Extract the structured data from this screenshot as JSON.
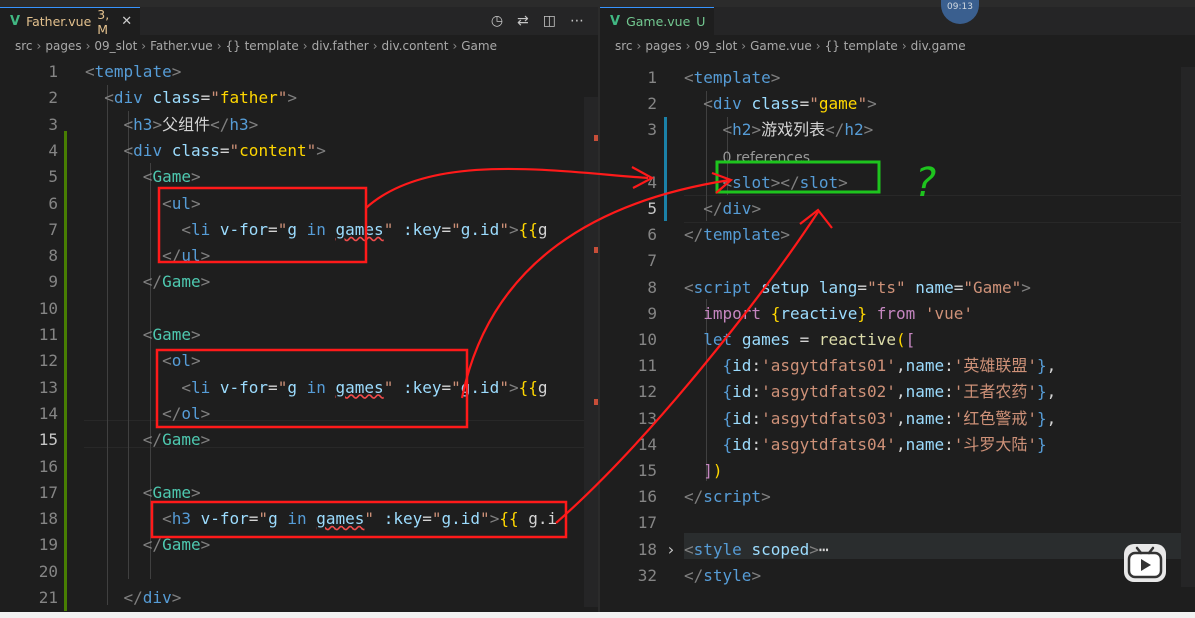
{
  "left_tab": {
    "label": "Father.vue",
    "badge": "3, M",
    "close": "✕"
  },
  "left_actions": [
    "history-icon",
    "compare-icon",
    "split-icon",
    "more-icon"
  ],
  "left_breadcrumb": [
    "src",
    "pages",
    "09_slot",
    "Father.vue",
    "{} template",
    "div.father",
    "div.content",
    "Game"
  ],
  "right_tab": {
    "label": "Game.vue",
    "badge": "U",
    "close": "✕"
  },
  "right_breadcrumb": [
    "src",
    "pages",
    "09_slot",
    "Game.vue",
    "{} template",
    "div.game"
  ],
  "overlay": {
    "avatar_text": "09:13",
    "question_mark": "?"
  },
  "left_lines": [
    {
      "n": "1",
      "indent": "",
      "segs": [
        [
          "b",
          "<"
        ],
        [
          "t",
          "template"
        ],
        [
          "b",
          ">"
        ]
      ]
    },
    {
      "n": "2",
      "indent": "  ",
      "segs": [
        [
          "b",
          "<"
        ],
        [
          "t",
          "div"
        ],
        [
          "w",
          " "
        ],
        [
          "a",
          "class"
        ],
        [
          "w",
          "="
        ],
        [
          "s",
          "\""
        ],
        [
          "y",
          "father"
        ],
        [
          "s",
          "\""
        ],
        [
          "b",
          ">"
        ]
      ]
    },
    {
      "n": "3",
      "indent": "    ",
      "segs": [
        [
          "b",
          "<"
        ],
        [
          "t",
          "h3"
        ],
        [
          "b",
          ">"
        ],
        [
          "w",
          "父组件"
        ],
        [
          "b",
          "</"
        ],
        [
          "t",
          "h3"
        ],
        [
          "b",
          ">"
        ]
      ]
    },
    {
      "n": "4",
      "indent": "    ",
      "segs": [
        [
          "b",
          "<"
        ],
        [
          "t",
          "div"
        ],
        [
          "w",
          " "
        ],
        [
          "a",
          "class"
        ],
        [
          "w",
          "="
        ],
        [
          "s",
          "\""
        ],
        [
          "y",
          "content"
        ],
        [
          "s",
          "\""
        ],
        [
          "b",
          ">"
        ]
      ]
    },
    {
      "n": "5",
      "indent": "      ",
      "segs": [
        [
          "b",
          "<"
        ],
        [
          "tg",
          "Game"
        ],
        [
          "b",
          ">"
        ]
      ]
    },
    {
      "n": "6",
      "indent": "        ",
      "segs": [
        [
          "b",
          "<"
        ],
        [
          "t",
          "ul"
        ],
        [
          "b",
          ">"
        ]
      ]
    },
    {
      "n": "7",
      "indent": "          ",
      "segs": [
        [
          "b",
          "<"
        ],
        [
          "t",
          "li"
        ],
        [
          "w",
          " "
        ],
        [
          "a",
          "v-for"
        ],
        [
          "w",
          "="
        ],
        [
          "s",
          "\""
        ],
        [
          "a",
          "g"
        ],
        [
          "w",
          " "
        ],
        [
          "t",
          "in"
        ],
        [
          "w",
          " "
        ],
        [
          "a",
          "games"
        ],
        [
          "s",
          "\""
        ],
        [
          "w",
          " "
        ],
        [
          "a",
          ":key"
        ],
        [
          "w",
          "="
        ],
        [
          "s",
          "\""
        ],
        [
          "a",
          "g.id"
        ],
        [
          "s",
          "\""
        ],
        [
          "b",
          ">"
        ],
        [
          "y",
          "{{"
        ],
        [
          "w",
          "g"
        ]
      ]
    },
    {
      "n": "8",
      "indent": "        ",
      "segs": [
        [
          "b",
          "</"
        ],
        [
          "t",
          "ul"
        ],
        [
          "b",
          ">"
        ]
      ]
    },
    {
      "n": "9",
      "indent": "      ",
      "segs": [
        [
          "b",
          "</"
        ],
        [
          "tg",
          "Game"
        ],
        [
          "b",
          ">"
        ]
      ]
    },
    {
      "n": "10",
      "indent": "",
      "segs": []
    },
    {
      "n": "11",
      "indent": "      ",
      "segs": [
        [
          "b",
          "<"
        ],
        [
          "tg",
          "Game"
        ],
        [
          "b",
          ">"
        ]
      ]
    },
    {
      "n": "12",
      "indent": "        ",
      "segs": [
        [
          "b",
          "<"
        ],
        [
          "t",
          "ol"
        ],
        [
          "b",
          ">"
        ]
      ]
    },
    {
      "n": "13",
      "indent": "          ",
      "segs": [
        [
          "b",
          "<"
        ],
        [
          "t",
          "li"
        ],
        [
          "w",
          " "
        ],
        [
          "a",
          "v-for"
        ],
        [
          "w",
          "="
        ],
        [
          "s",
          "\""
        ],
        [
          "a",
          "g"
        ],
        [
          "w",
          " "
        ],
        [
          "t",
          "in"
        ],
        [
          "w",
          " "
        ],
        [
          "a",
          "games"
        ],
        [
          "s",
          "\""
        ],
        [
          "w",
          " "
        ],
        [
          "a",
          ":key"
        ],
        [
          "w",
          "="
        ],
        [
          "s",
          "\""
        ],
        [
          "a",
          "g.id"
        ],
        [
          "s",
          "\""
        ],
        [
          "b",
          ">"
        ],
        [
          "y",
          "{{"
        ],
        [
          "w",
          "g"
        ]
      ]
    },
    {
      "n": "14",
      "indent": "        ",
      "segs": [
        [
          "b",
          "</"
        ],
        [
          "t",
          "ol"
        ],
        [
          "b",
          ">"
        ]
      ]
    },
    {
      "n": "15",
      "indent": "      ",
      "segs": [
        [
          "b",
          "</"
        ],
        [
          "tg",
          "Game"
        ],
        [
          "b",
          ">"
        ]
      ],
      "active": true
    },
    {
      "n": "16",
      "indent": "",
      "segs": []
    },
    {
      "n": "17",
      "indent": "      ",
      "segs": [
        [
          "b",
          "<"
        ],
        [
          "tg",
          "Game"
        ],
        [
          "b",
          ">"
        ]
      ]
    },
    {
      "n": "18",
      "indent": "        ",
      "segs": [
        [
          "b",
          "<"
        ],
        [
          "t",
          "h3"
        ],
        [
          "w",
          " "
        ],
        [
          "a",
          "v-for"
        ],
        [
          "w",
          "="
        ],
        [
          "s",
          "\""
        ],
        [
          "a",
          "g"
        ],
        [
          "w",
          " "
        ],
        [
          "t",
          "in"
        ],
        [
          "w",
          " "
        ],
        [
          "a",
          "games"
        ],
        [
          "s",
          "\""
        ],
        [
          "w",
          " "
        ],
        [
          "a",
          ":key"
        ],
        [
          "w",
          "="
        ],
        [
          "s",
          "\""
        ],
        [
          "a",
          "g.id"
        ],
        [
          "s",
          "\""
        ],
        [
          "b",
          ">"
        ],
        [
          "y",
          "{{"
        ],
        [
          "w",
          " g.i"
        ]
      ]
    },
    {
      "n": "19",
      "indent": "      ",
      "segs": [
        [
          "b",
          "</"
        ],
        [
          "tg",
          "Game"
        ],
        [
          "b",
          ">"
        ]
      ]
    },
    {
      "n": "20",
      "indent": "",
      "segs": []
    },
    {
      "n": "21",
      "indent": "    ",
      "segs": [
        [
          "b",
          "</"
        ],
        [
          "t",
          "div"
        ],
        [
          "b",
          ">"
        ]
      ]
    }
  ],
  "right_lines": [
    {
      "n": "1",
      "indent": "",
      "segs": [
        [
          "b",
          "<"
        ],
        [
          "t",
          "template"
        ],
        [
          "b",
          ">"
        ]
      ]
    },
    {
      "n": "2",
      "indent": "  ",
      "segs": [
        [
          "b",
          "<"
        ],
        [
          "t",
          "div"
        ],
        [
          "w",
          " "
        ],
        [
          "a",
          "class"
        ],
        [
          "w",
          "="
        ],
        [
          "s",
          "\""
        ],
        [
          "y",
          "game"
        ],
        [
          "s",
          "\""
        ],
        [
          "b",
          ">"
        ]
      ]
    },
    {
      "n": "3",
      "indent": "    ",
      "segs": [
        [
          "b",
          "<"
        ],
        [
          "t",
          "h2"
        ],
        [
          "b",
          ">"
        ],
        [
          "w",
          "游戏列表"
        ],
        [
          "b",
          "</"
        ],
        [
          "t",
          "h2"
        ],
        [
          "b",
          ">"
        ]
      ]
    },
    {
      "n": "",
      "indent": "    ",
      "segs": [
        [
          "refs",
          "0 references"
        ]
      ]
    },
    {
      "n": "4",
      "indent": "    ",
      "segs": [
        [
          "b",
          "<"
        ],
        [
          "t",
          "slot"
        ],
        [
          "b",
          "></"
        ],
        [
          "t",
          "slot"
        ],
        [
          "b",
          ">"
        ]
      ]
    },
    {
      "n": "5",
      "indent": "  ",
      "segs": [
        [
          "b",
          "</"
        ],
        [
          "t",
          "div"
        ],
        [
          "b",
          ">"
        ]
      ],
      "active": true
    },
    {
      "n": "6",
      "indent": "",
      "segs": [
        [
          "b",
          "</"
        ],
        [
          "t",
          "template"
        ],
        [
          "b",
          ">"
        ]
      ]
    },
    {
      "n": "7",
      "indent": "",
      "segs": []
    },
    {
      "n": "8",
      "indent": "",
      "segs": [
        [
          "b",
          "<"
        ],
        [
          "t",
          "script"
        ],
        [
          "w",
          " "
        ],
        [
          "a",
          "setup"
        ],
        [
          "w",
          " "
        ],
        [
          "a",
          "lang"
        ],
        [
          "w",
          "="
        ],
        [
          "s",
          "\"ts\""
        ],
        [
          "w",
          " "
        ],
        [
          "a",
          "name"
        ],
        [
          "w",
          "="
        ],
        [
          "s",
          "\"Game\""
        ],
        [
          "b",
          ">"
        ]
      ]
    },
    {
      "n": "9",
      "indent": "  ",
      "segs": [
        [
          "k",
          "import"
        ],
        [
          "w",
          " "
        ],
        [
          "y",
          "{"
        ],
        [
          "a",
          "reactive"
        ],
        [
          "y",
          "}"
        ],
        [
          "w",
          " "
        ],
        [
          "k",
          "from"
        ],
        [
          "w",
          " "
        ],
        [
          "s",
          "'vue'"
        ]
      ]
    },
    {
      "n": "10",
      "indent": "  ",
      "segs": [
        [
          "t",
          "let"
        ],
        [
          "w",
          " "
        ],
        [
          "a",
          "games"
        ],
        [
          "w",
          " = "
        ],
        [
          "f",
          "reactive"
        ],
        [
          "y",
          "("
        ],
        [
          "k",
          "["
        ]
      ]
    },
    {
      "n": "11",
      "indent": "    ",
      "segs": [
        [
          "t",
          "{"
        ],
        [
          "a",
          "id"
        ],
        [
          "w",
          ":"
        ],
        [
          "s",
          "'asgytdfats01'"
        ],
        [
          "w",
          ","
        ],
        [
          "a",
          "name"
        ],
        [
          "w",
          ":"
        ],
        [
          "s",
          "'英雄联盟'"
        ],
        [
          "t",
          "}"
        ],
        [
          "w",
          ","
        ]
      ]
    },
    {
      "n": "12",
      "indent": "    ",
      "segs": [
        [
          "t",
          "{"
        ],
        [
          "a",
          "id"
        ],
        [
          "w",
          ":"
        ],
        [
          "s",
          "'asgytdfats02'"
        ],
        [
          "w",
          ","
        ],
        [
          "a",
          "name"
        ],
        [
          "w",
          ":"
        ],
        [
          "s",
          "'王者农药'"
        ],
        [
          "t",
          "}"
        ],
        [
          "w",
          ","
        ]
      ]
    },
    {
      "n": "13",
      "indent": "    ",
      "segs": [
        [
          "t",
          "{"
        ],
        [
          "a",
          "id"
        ],
        [
          "w",
          ":"
        ],
        [
          "s",
          "'asgytdfats03'"
        ],
        [
          "w",
          ","
        ],
        [
          "a",
          "name"
        ],
        [
          "w",
          ":"
        ],
        [
          "s",
          "'红色警戒'"
        ],
        [
          "t",
          "}"
        ],
        [
          "w",
          ","
        ]
      ]
    },
    {
      "n": "14",
      "indent": "    ",
      "segs": [
        [
          "t",
          "{"
        ],
        [
          "a",
          "id"
        ],
        [
          "w",
          ":"
        ],
        [
          "s",
          "'asgytdfats04'"
        ],
        [
          "w",
          ","
        ],
        [
          "a",
          "name"
        ],
        [
          "w",
          ":"
        ],
        [
          "s",
          "'斗罗大陆'"
        ],
        [
          "t",
          "}"
        ]
      ]
    },
    {
      "n": "15",
      "indent": "  ",
      "segs": [
        [
          "k",
          "]"
        ],
        [
          "y",
          ")"
        ]
      ]
    },
    {
      "n": "16",
      "indent": "",
      "segs": [
        [
          "b",
          "</"
        ],
        [
          "t",
          "script"
        ],
        [
          "b",
          ">"
        ]
      ]
    },
    {
      "n": "17",
      "indent": "",
      "segs": []
    },
    {
      "n": "18",
      "indent": "",
      "segs": [
        [
          "b",
          "<"
        ],
        [
          "t",
          "style"
        ],
        [
          "w",
          " "
        ],
        [
          "a",
          "scoped"
        ],
        [
          "b",
          ">"
        ],
        [
          "w",
          "⋯"
        ]
      ],
      "fold": true
    },
    {
      "n": "32",
      "indent": "",
      "segs": [
        [
          "b",
          "</"
        ],
        [
          "t",
          "style"
        ],
        [
          "b",
          ">"
        ]
      ]
    }
  ]
}
